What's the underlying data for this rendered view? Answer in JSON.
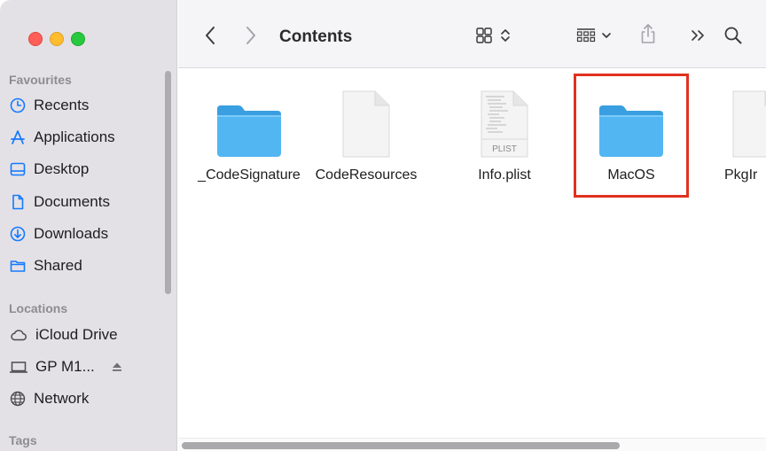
{
  "toolbar": {
    "title": "Contents",
    "icons": [
      "back-chevron-icon",
      "forward-chevron-icon",
      "icon-view-grid-icon",
      "sort-updown-icon",
      "group-icon",
      "chevron-down-icon",
      "share-icon",
      "more-chevron-icon",
      "search-icon"
    ]
  },
  "sidebar": {
    "favourites_title": "Favourites",
    "favourites": [
      {
        "label": "Recents",
        "icon": "clock-icon"
      },
      {
        "label": "Applications",
        "icon": "applications-icon"
      },
      {
        "label": "Desktop",
        "icon": "desktop-icon"
      },
      {
        "label": "Documents",
        "icon": "document-icon"
      },
      {
        "label": "Downloads",
        "icon": "download-icon"
      },
      {
        "label": "Shared",
        "icon": "folder-icon"
      }
    ],
    "locations_title": "Locations",
    "locations": [
      {
        "label": "iCloud Drive",
        "icon": "cloud-icon"
      },
      {
        "label": "GP M1...",
        "icon": "laptop-icon"
      },
      {
        "label": "Network",
        "icon": "globe-icon"
      }
    ],
    "tags_title": "Tags"
  },
  "files": [
    {
      "name": "_CodeSignature",
      "type": "folder"
    },
    {
      "name": "CodeResources",
      "type": "document"
    },
    {
      "name": "Info.plist",
      "type": "plist",
      "badge": "PLIST"
    },
    {
      "name": "MacOS",
      "type": "folder",
      "highlighted": true
    },
    {
      "name": "PkgIr",
      "type": "document"
    }
  ],
  "colors": {
    "accent": "#147aff",
    "folder": "#49b0ef",
    "highlight_border": "#e0311f",
    "sidebar_bg": "#e4e1e6"
  }
}
